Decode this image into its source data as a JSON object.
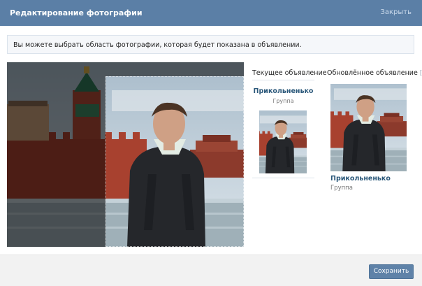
{
  "header": {
    "title": "Редактирование фотографии",
    "close_label": "Закрыть"
  },
  "notice": {
    "text": "Вы можете выбрать область фотографии, которая будет показана в объявлении."
  },
  "preview": {
    "current_title": "Текущее объявление",
    "updated_title": "Обновлённое объявление",
    "help_mark": "[?]",
    "ad_name": "Прикольненько",
    "ad_type": "Группа"
  },
  "footer": {
    "save_label": "Сохранить"
  },
  "colors": {
    "header_bg": "#5b7fa6",
    "link": "#2b587a",
    "button_bg": "#5f82a8",
    "footer_bg": "#f2f2f2"
  }
}
